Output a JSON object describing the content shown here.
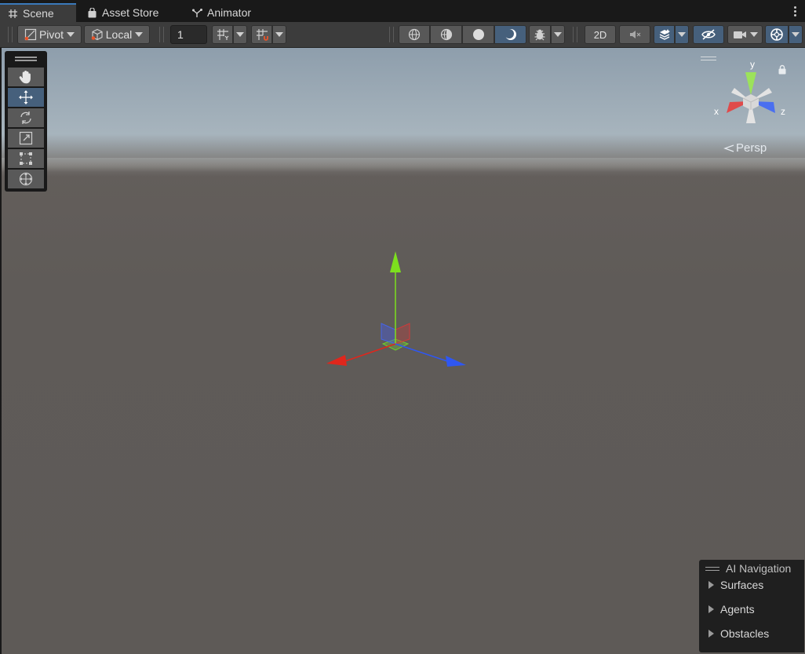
{
  "tabs": [
    {
      "label": "Scene",
      "icon": "grid-icon",
      "active": true
    },
    {
      "label": "Asset Store",
      "icon": "bag-icon",
      "active": false
    },
    {
      "label": "Animator",
      "icon": "animator-icon",
      "active": false
    }
  ],
  "toolbar": {
    "pivot_label": "Pivot",
    "local_label": "Local",
    "grid_size_value": "1",
    "mode_2d_label": "2D"
  },
  "gizmo": {
    "y_label": "y",
    "x_label": "x",
    "z_label": "z",
    "projection_label": "Persp"
  },
  "ai_navigation": {
    "title": "AI Navigation",
    "items": [
      "Surfaces",
      "Agents",
      "Obstacles"
    ]
  },
  "colors": {
    "accent": "#3a79bb",
    "selected": "#46607c",
    "axis_x": "#e0261c",
    "axis_y": "#7de01e",
    "axis_z": "#2f57f2"
  }
}
